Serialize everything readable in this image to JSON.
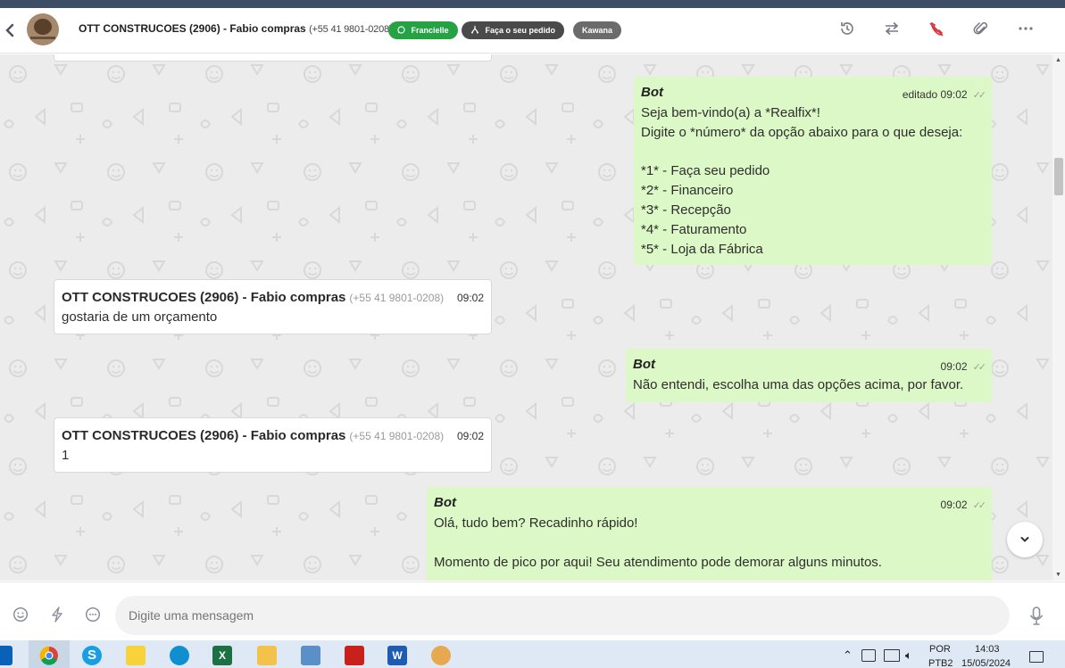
{
  "header": {
    "back_icon": "chevron-left-icon",
    "contact_name": "OTT CONSTRUCOES (2906) - Fabio compras",
    "contact_phone": "(+55 41 9801-0208)",
    "tags": [
      {
        "label": "Francielle",
        "icon": "whatsapp-icon",
        "color": "#25a244"
      },
      {
        "label": "Faça o seu pedido",
        "icon": "flow-icon",
        "color": "#4a4a4a"
      },
      {
        "label": "Kawana",
        "color": "#6b6b6b"
      }
    ],
    "actions": [
      "history-icon",
      "transfer-icon",
      "end-call-icon",
      "attach-icon",
      "more-icon"
    ]
  },
  "messages": [
    {
      "direction": "out",
      "sender": "Bot",
      "time_label": "editado 09:02",
      "lines": [
        "Seja bem-vindo(a) a *Realfix*!",
        "Digite o *número* da opção abaixo para o que deseja:",
        "",
        "*1* - Faça seu pedido",
        "*2* - Financeiro",
        "*3* - Recepção",
        "*4* - Faturamento",
        "*5* - Loja da Fábrica"
      ]
    },
    {
      "direction": "in",
      "sender": "OTT CONSTRUCOES (2906) - Fabio compras",
      "phone": "(+55 41 9801-0208)",
      "time_label": "09:02",
      "lines": [
        "gostaria de um orçamento"
      ]
    },
    {
      "direction": "out",
      "sender": "Bot",
      "time_label": "09:02",
      "lines": [
        "Não entendi, escolha uma das opções acima, por favor."
      ]
    },
    {
      "direction": "in",
      "sender": "OTT CONSTRUCOES (2906) - Fabio compras",
      "phone": "(+55 41 9801-0208)",
      "time_label": "09:02",
      "lines": [
        "1"
      ]
    },
    {
      "direction": "out",
      "sender": "Bot",
      "time_label": "09:02",
      "lines": [
        "Olá, tudo bem? Recadinho rápido!",
        "",
        "Momento de pico por aqui! Seu atendimento pode demorar alguns minutos."
      ]
    }
  ],
  "composer": {
    "placeholder": "Digite uma mensagem",
    "icons": [
      "emoji-icon",
      "quick-reply-icon",
      "chat-bubble-icon",
      "microphone-icon"
    ]
  },
  "taskbar": {
    "apps": [
      "outlook-icon",
      "chrome-icon",
      "skype-icon",
      "sticky-notes-icon",
      "edge-icon",
      "excel-icon",
      "file-explorer-icon",
      "control-panel-icon",
      "acrobat-icon",
      "word-icon",
      "paint-icon"
    ],
    "language_line1": "POR",
    "language_line2": "PTB2",
    "time": "14:03",
    "date": "15/05/2024"
  },
  "colors": {
    "outgoing_bubble": "#dcf8c6",
    "incoming_bubble": "#ffffff",
    "chat_background": "#ececec",
    "whatsapp_tag": "#25a244"
  }
}
